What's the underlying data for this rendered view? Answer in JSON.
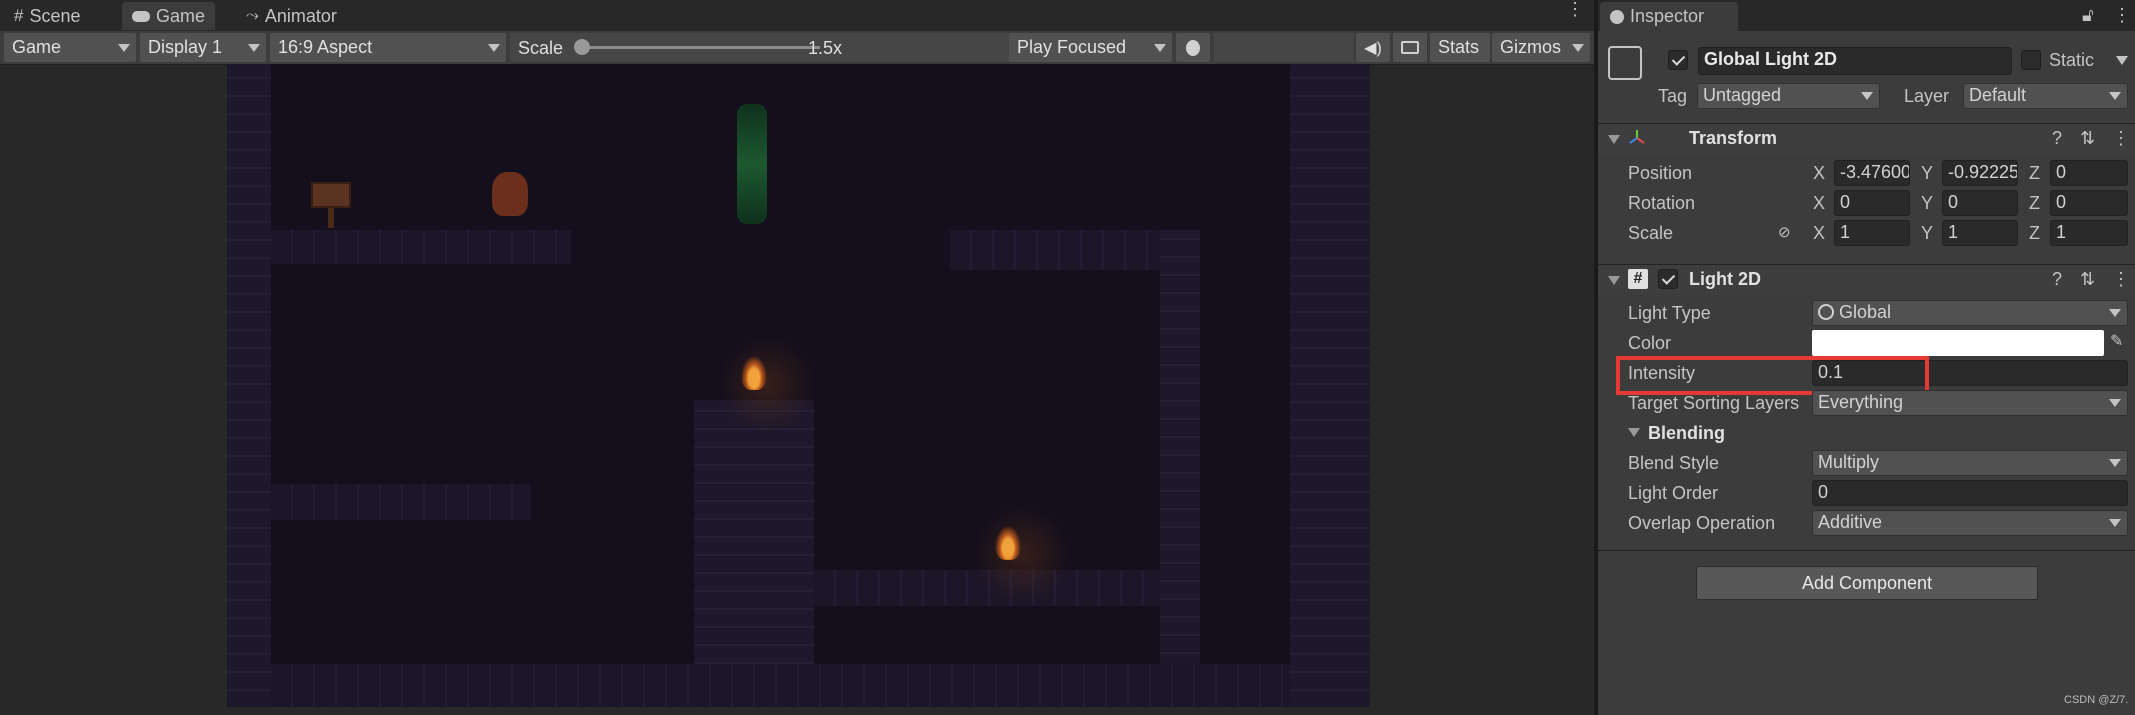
{
  "tabs": {
    "scene": "Scene",
    "game": "Game",
    "animator": "Animator"
  },
  "toolbar": {
    "game_dropdown": "Game",
    "display": "Display 1",
    "aspect": "16:9 Aspect",
    "scale_label": "Scale",
    "scale_value": "1.5x",
    "scale_fraction": 0.0,
    "play_mode": "Play Focused",
    "stats": "Stats",
    "gizmos": "Gizmos"
  },
  "inspector": {
    "tab": "Inspector",
    "object_name": "Global Light 2D",
    "active": true,
    "static_label": "Static",
    "tag_label": "Tag",
    "tag_value": "Untagged",
    "layer_label": "Layer",
    "layer_value": "Default",
    "transform": {
      "title": "Transform",
      "position_label": "Position",
      "rotation_label": "Rotation",
      "scale_label": "Scale",
      "x": "X",
      "y": "Y",
      "z": "Z",
      "position": [
        "-3.47600",
        "-0.92225",
        "0"
      ],
      "rotation": [
        "0",
        "0",
        "0"
      ],
      "scale": [
        "1",
        "1",
        "1"
      ]
    },
    "light2d": {
      "title": "Light 2D",
      "enabled": true,
      "light_type_label": "Light Type",
      "light_type_value": "Global",
      "color_label": "Color",
      "color_value": "#ffffff",
      "intensity_label": "Intensity",
      "intensity_value": "0.1",
      "sorting_label": "Target Sorting Layers",
      "sorting_value": "Everything",
      "blending_title": "Blending",
      "blend_style_label": "Blend Style",
      "blend_style_value": "Multiply",
      "light_order_label": "Light Order",
      "light_order_value": "0",
      "overlap_label": "Overlap Operation",
      "overlap_value": "Additive"
    },
    "add_component": "Add Component"
  },
  "watermark": "CSDN @Z/7.",
  "colors": {
    "highlight_box": "#e53935",
    "panel_bg": "#3c3c3c",
    "game_bg": "#130f1c"
  }
}
